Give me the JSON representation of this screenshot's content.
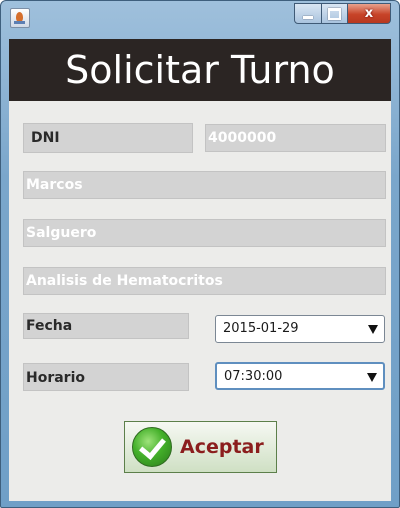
{
  "window": {
    "controls": {
      "close_glyph": "x"
    }
  },
  "header": {
    "title": "Solicitar Turno"
  },
  "form": {
    "dni_label": "DNI",
    "dni_value": "4000000",
    "nombre": "Marcos",
    "apellido": "Salguero",
    "estudio": "Analisis de Hematocritos",
    "fecha_label": "Fecha",
    "fecha_value": "2015-01-29",
    "horario_label": "Horario",
    "horario_value": "07:30:00"
  },
  "actions": {
    "aceptar_label": "Aceptar"
  },
  "colors": {
    "header_bg": "#2b2523",
    "field_bg": "#d3d3d3",
    "button_text": "#8b1d1d",
    "window_frame": "#7aa6cb"
  },
  "icons": [
    "app-icon",
    "minimize-icon",
    "maximize-icon",
    "close-icon",
    "chevron-down-icon",
    "checkmark-icon"
  ]
}
